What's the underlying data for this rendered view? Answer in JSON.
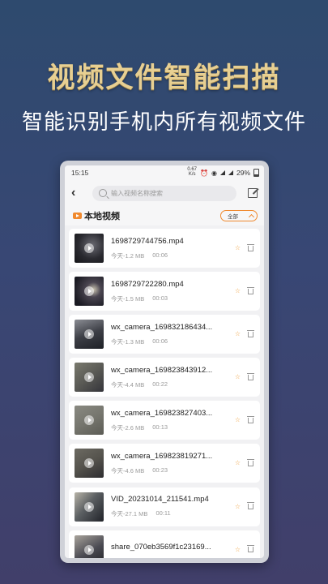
{
  "promo": {
    "title": "视频文件智能扫描",
    "subtitle": "智能识别手机内所有视频文件"
  },
  "status_bar": {
    "time": "15:15",
    "speed_value": "0.67",
    "speed_unit": "K/s",
    "battery": "29%"
  },
  "search": {
    "placeholder": "输入视频名称搜索"
  },
  "section": {
    "title": "本地视频",
    "filter_label": "全部"
  },
  "videos": [
    {
      "name": "1698729744756.mp4",
      "size": "今天-1.2 MB",
      "duration": "00:06"
    },
    {
      "name": "1698729722280.mp4",
      "size": "今天-1.5 MB",
      "duration": "00:03"
    },
    {
      "name": "wx_camera_169832186434...",
      "size": "今天-1.3 MB",
      "duration": "00:06"
    },
    {
      "name": "wx_camera_169823843912...",
      "size": "今天-4.4 MB",
      "duration": "00:22"
    },
    {
      "name": "wx_camera_169823827403...",
      "size": "今天-2.6 MB",
      "duration": "00:13"
    },
    {
      "name": "wx_camera_169823819271...",
      "size": "今天-4.6 MB",
      "duration": "00:23"
    },
    {
      "name": "VID_20231014_211541.mp4",
      "size": "今天-27.1 MB",
      "duration": "00:11"
    },
    {
      "name": "share_070eb3569f1c23169...",
      "size": "",
      "duration": ""
    }
  ],
  "colors": {
    "accent": "#f0892e",
    "star": "#f0a64a",
    "title_gold": "#e7cf92"
  }
}
